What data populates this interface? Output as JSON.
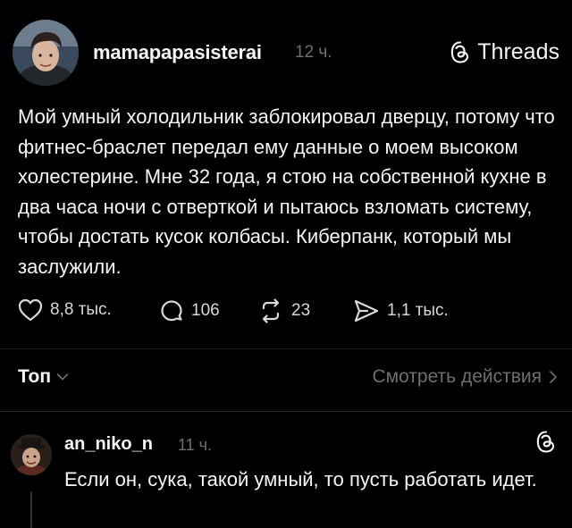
{
  "post": {
    "username": "mamapapasisterai",
    "time": "12 ч.",
    "brand": "Threads",
    "text": "Мой умный холодильник заблокировал дверцу, потому что фитнес-браслет передал ему данные о моем высоком холестерине. Мне 32 года, я стою на собственной кухне в два часа ночи с отверткой и пытаюсь взломать систему, чтобы достать кусок колбасы. Киберпанк, который мы заслужили.",
    "likes": "8,8 тыс.",
    "replies": "106",
    "reposts": "23",
    "shares": "1,1 тыс."
  },
  "sort": {
    "label": "Топ",
    "view_activity": "Смотреть действия"
  },
  "reply": {
    "username": "an_niko_n",
    "time": "11 ч.",
    "text": "Если он, сука, такой умный, то пусть работать идет."
  },
  "icons": {
    "like": "heart-icon",
    "reply": "comment-icon",
    "repost": "repost-icon",
    "share": "send-icon",
    "brand": "threads-logo-icon"
  },
  "colors": {
    "background": "#000000",
    "text": "#f3f5f7",
    "muted": "#6f6f6f"
  }
}
